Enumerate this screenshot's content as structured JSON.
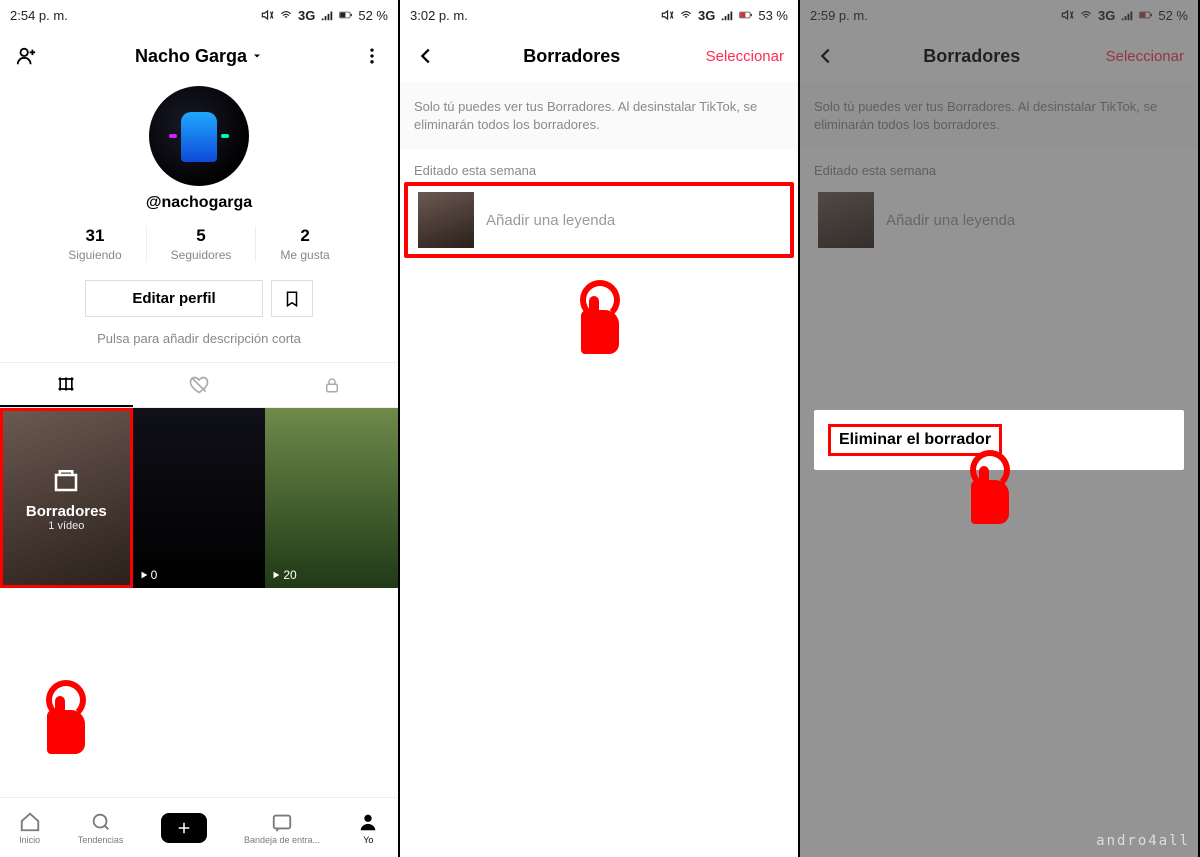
{
  "screen1": {
    "status": {
      "time": "2:54 p. m.",
      "net": "3G",
      "battery": "52 %"
    },
    "header": {
      "title": "Nacho Garga"
    },
    "handle": "@nachogarga",
    "stats": {
      "following": {
        "num": "31",
        "label": "Siguiendo"
      },
      "followers": {
        "num": "5",
        "label": "Seguidores"
      },
      "likes": {
        "num": "2",
        "label": "Me gusta"
      }
    },
    "edit_label": "Editar perfil",
    "bio_hint": "Pulsa para añadir descripción corta",
    "drafts": {
      "title": "Borradores",
      "sub": "1 vídeo"
    },
    "plays": {
      "v1": "0",
      "v2": "20"
    },
    "nav": {
      "home": "Inicio",
      "trending": "Tendencias",
      "inbox": "Bandeja de entra...",
      "me": "Yo"
    }
  },
  "screen2": {
    "status": {
      "time": "3:02 p. m.",
      "net": "3G",
      "battery": "53 %"
    },
    "header": {
      "title": "Borradores",
      "action": "Seleccionar"
    },
    "notice": "Solo tú puedes ver tus Borradores. Al desinstalar TikTok, se eliminarán todos los borradores.",
    "section": "Editado esta semana",
    "caption_hint": "Añadir una leyenda"
  },
  "screen3": {
    "status": {
      "time": "2:59 p. m.",
      "net": "3G",
      "battery": "52 %"
    },
    "header": {
      "title": "Borradores",
      "action": "Seleccionar"
    },
    "notice": "Solo tú puedes ver tus Borradores. Al desinstalar TikTok, se eliminarán todos los borradores.",
    "section": "Editado esta semana",
    "caption_hint": "Añadir una leyenda",
    "delete_label": "Eliminar el borrador"
  },
  "watermark": "andro4all"
}
